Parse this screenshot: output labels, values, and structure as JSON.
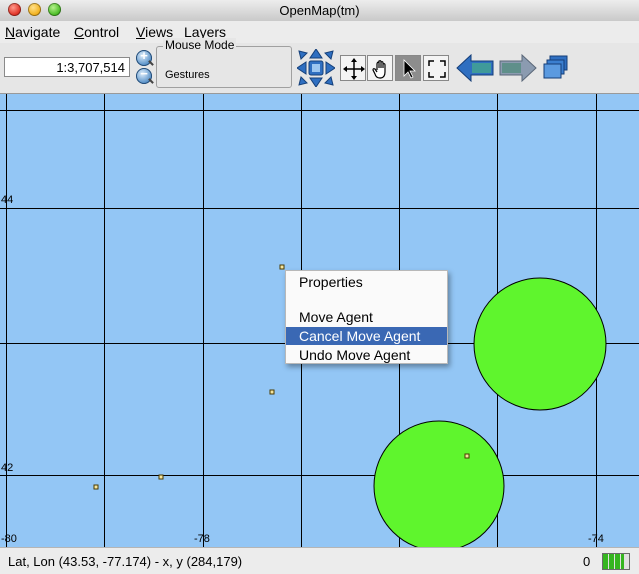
{
  "window": {
    "title": "OpenMap(tm)"
  },
  "menubar": {
    "items": [
      {
        "mnemonic": "N",
        "rest": "avigate"
      },
      {
        "mnemonic": "C",
        "rest": "ontrol"
      },
      {
        "mnemonic": "V",
        "rest": "iews"
      },
      {
        "mnemonic": "L",
        "rest": "ayers"
      }
    ]
  },
  "toolbar": {
    "scale_value": "1:3,707,514",
    "mouse_mode": {
      "title": "Mouse Mode",
      "value": "Gestures"
    },
    "icons": [
      "pan-arrows-icon",
      "move-icon",
      "hand-grab-icon",
      "pointer-arrow-icon",
      "select-box-icon",
      "back-icon",
      "forward-icon",
      "layers-stack-icon"
    ]
  },
  "map": {
    "x_ticks": [
      "-80",
      "-78",
      "-74"
    ],
    "y_ticks": [
      "44",
      "42"
    ],
    "colors": {
      "water": "#93c6f5",
      "circle": "#5ff52d",
      "grid": "#000000"
    }
  },
  "context_menu": {
    "items": [
      "Properties",
      "Move Agent",
      "Cancel Move Agent",
      "Undo Move Agent"
    ],
    "highlighted": "Cancel Move Agent",
    "highlight_color": "#3a68b4"
  },
  "statusbar": {
    "text": "Lat, Lon (43.53, -77.174) - x, y (284,179)",
    "count": "0"
  }
}
